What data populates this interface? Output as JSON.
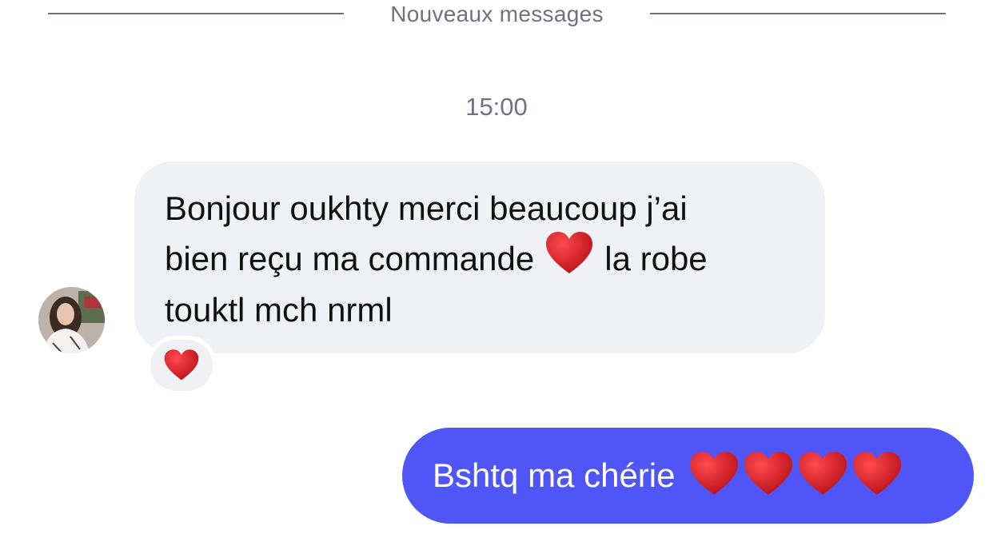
{
  "divider": {
    "label": "Nouveaux messages"
  },
  "timestamp": "15:00",
  "incoming_message": {
    "line1": "Bonjour oukhty merci beaucoup j’ai",
    "line2_before": "bien reçu ma commande",
    "line2_emoji": "red-heart-icon",
    "line2_after": "la robe",
    "line3": "touktl mch nrml",
    "reaction": "red-heart-icon"
  },
  "outgoing_message": {
    "text": "Bshtq ma chérie",
    "emojis": [
      "red-heart-icon",
      "red-heart-icon",
      "red-heart-icon",
      "red-heart-icon"
    ]
  },
  "colors": {
    "outgoing_bubble": "#4f55f6",
    "incoming_bubble": "#eff1f4",
    "meta_text": "#6e7281",
    "heart": "#d8141b"
  }
}
